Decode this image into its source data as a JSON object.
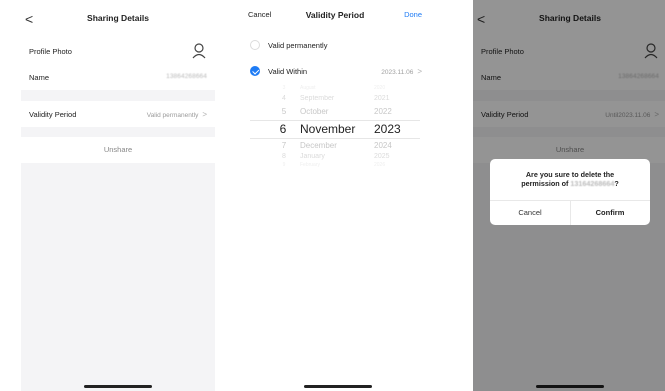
{
  "sharing_details": {
    "title": "Sharing Details",
    "back_glyph": "<",
    "profile_photo_label": "Profile Photo",
    "profile_icon": "user-icon",
    "name_label": "Name",
    "name_value": "13864268664",
    "validity_label": "Validity Period",
    "validity_value": "Valid permanently",
    "chevron": ">",
    "unshare_label": "Unshare"
  },
  "validity_sheet": {
    "cancel_label": "Cancel",
    "title": "Validity Period",
    "done_label": "Done",
    "done_color": "#1f7cf5",
    "option_permanent": "Valid permanently",
    "option_within": "Valid Within",
    "option_within_value": "2023.11.06",
    "chevron": ">",
    "picker": [
      {
        "day": "3",
        "month": "August",
        "year": "2020"
      },
      {
        "day": "4",
        "month": "September",
        "year": "2021"
      },
      {
        "day": "5",
        "month": "October",
        "year": "2022"
      },
      {
        "day": "6",
        "month": "November",
        "year": "2023"
      },
      {
        "day": "7",
        "month": "December",
        "year": "2024"
      },
      {
        "day": "8",
        "month": "January",
        "year": "2025"
      },
      {
        "day": "9",
        "month": "February",
        "year": "2026"
      }
    ]
  },
  "confirm_screen": {
    "title": "Sharing Details",
    "back_glyph": "<",
    "profile_photo_label": "Profile Photo",
    "name_label": "Name",
    "name_value": "13864268664",
    "validity_label": "Validity Period",
    "validity_value": "Until2023.11.06",
    "chevron": ">",
    "unshare_label": "Unshare",
    "dialog": {
      "message_line1": "Are you sure to delete the",
      "message_line2_prefix": "permission of ",
      "message_phone": "13164268664",
      "message_suffix": "?",
      "cancel_label": "Cancel",
      "confirm_label": "Confirm"
    }
  }
}
